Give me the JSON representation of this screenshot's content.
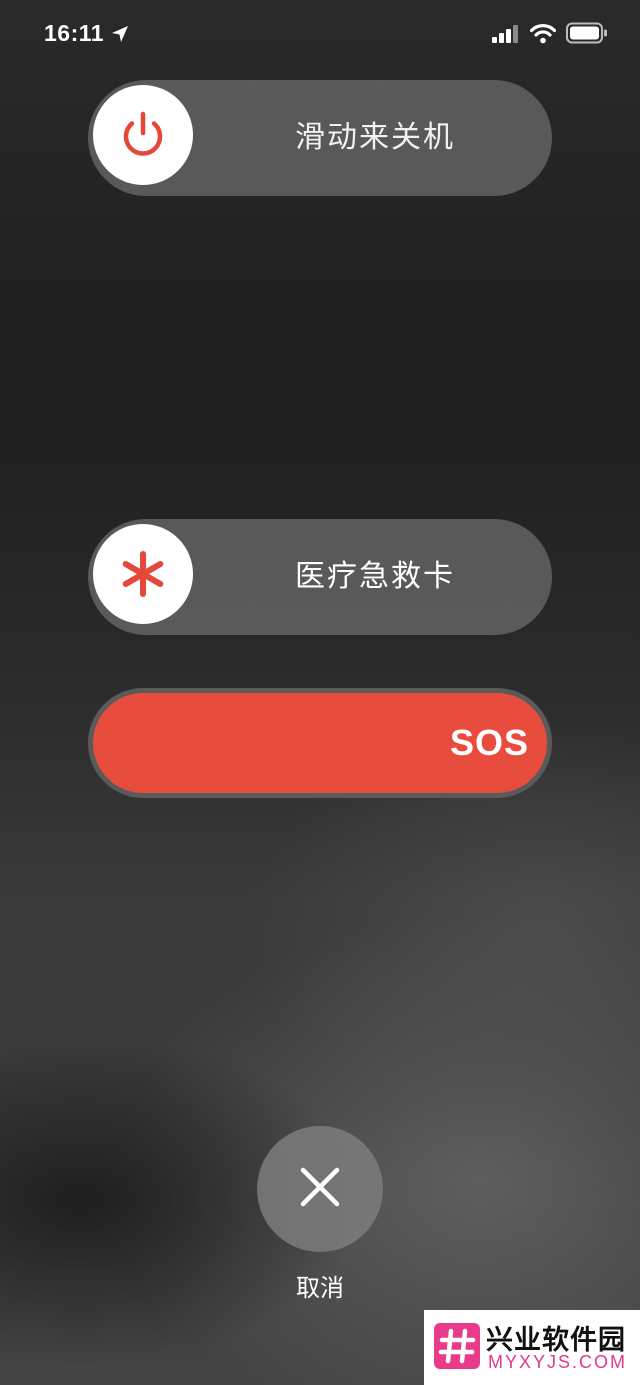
{
  "status_bar": {
    "time": "16:11",
    "icons": [
      "location-arrow-icon",
      "cellular-signal-icon",
      "wifi-icon",
      "battery-icon"
    ]
  },
  "power_slider": {
    "icon": "power-icon",
    "label": "滑动来关机",
    "accent_color": "#e5473a"
  },
  "medical_slider": {
    "icon": "medical-asterisk-icon",
    "label": "医疗急救卡",
    "accent_color": "#e5473a"
  },
  "sos_slider": {
    "label": "SOS",
    "color": "#e84c3d"
  },
  "cancel": {
    "icon": "close-icon",
    "label": "取消"
  },
  "watermark": {
    "title": "兴业软件园",
    "url": "MYXYJS.COM",
    "logo_color": "#e83c8a"
  }
}
